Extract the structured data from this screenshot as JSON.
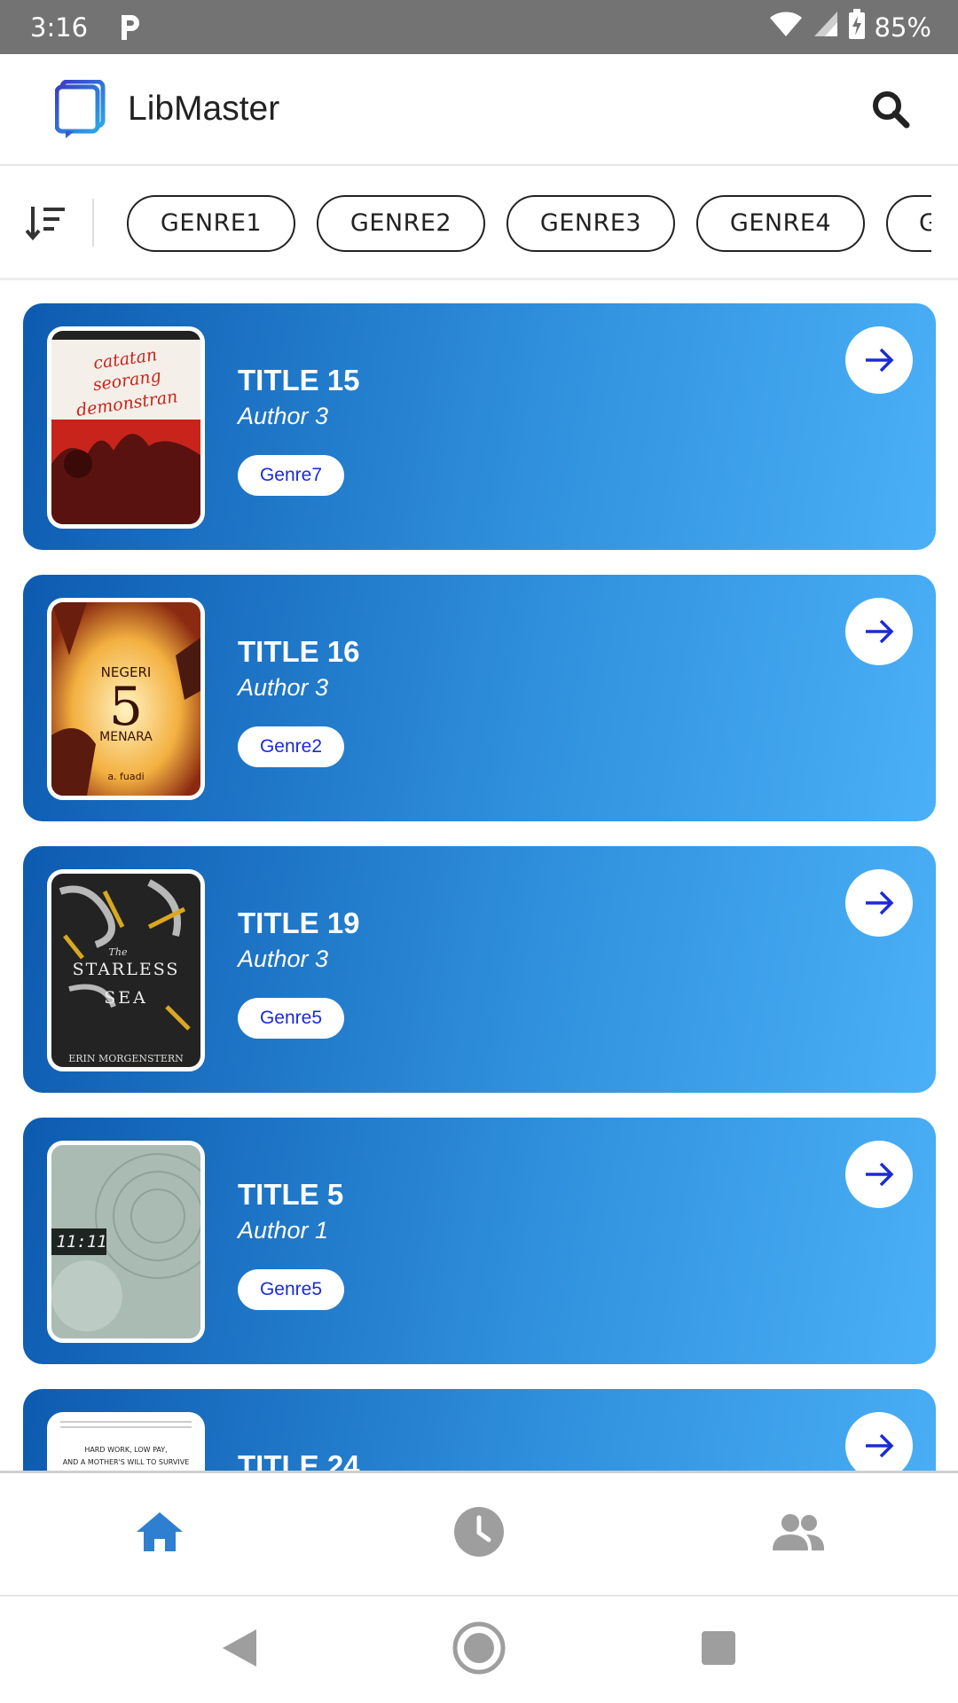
{
  "status_bar": {
    "time": "3:16",
    "battery": "85%"
  },
  "app_bar": {
    "title": "LibMaster"
  },
  "filters": {
    "chips": [
      "GENRE1",
      "GENRE2",
      "GENRE3",
      "GENRE4",
      "G"
    ]
  },
  "books": [
    {
      "title": "TITLE 15",
      "author": "Author 3",
      "genre": "Genre7",
      "cover_text": [
        "catatan",
        "seorang",
        "demonstran"
      ]
    },
    {
      "title": "TITLE 16",
      "author": "Author 3",
      "genre": "Genre2",
      "cover_text": [
        "NEGERI",
        "5",
        "MENARA",
        "a. fuadi"
      ]
    },
    {
      "title": "TITLE 19",
      "author": "Author 3",
      "genre": "Genre5",
      "cover_text": [
        "The",
        "STARLESS",
        "SEA",
        "ERIN MORGENSTERN"
      ]
    },
    {
      "title": "TITLE 5",
      "author": "Author 1",
      "genre": "Genre5",
      "cover_text": [
        "11:11"
      ]
    },
    {
      "title": "TITLE 24",
      "author": "",
      "genre": "",
      "cover_text": [
        "HARD WORK, LOW PAY,",
        "AND A MOTHER'S WILL TO SURVIVE"
      ]
    }
  ],
  "colors": {
    "card_gradient_start": "#0d5bb0",
    "card_gradient_end": "#4ab0f7",
    "active_nav": "#2f7fd0",
    "inactive_nav": "#9e9e9e",
    "genre_text": "#1a2bd6"
  },
  "bottom_nav": {
    "items": [
      {
        "icon": "home-icon",
        "active": true
      },
      {
        "icon": "history-icon",
        "active": false
      },
      {
        "icon": "people-icon",
        "active": false
      }
    ]
  }
}
